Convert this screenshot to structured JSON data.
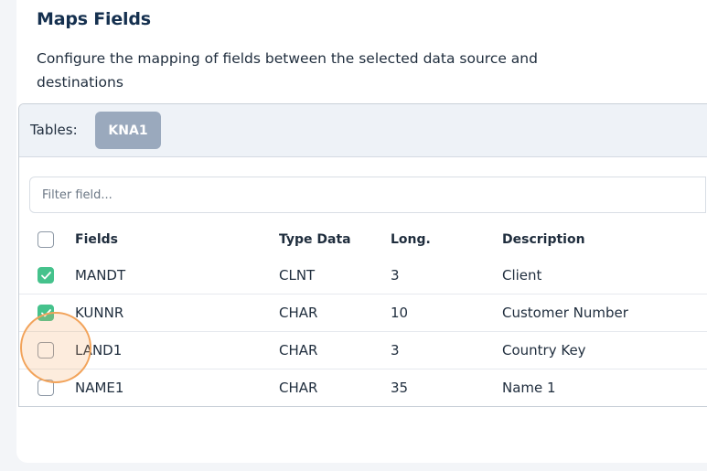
{
  "section": {
    "title": "Maps Fields",
    "description": "Configure the mapping of fields between the selected data source and destinations"
  },
  "tables": {
    "label": "Tables:",
    "selected": "KNA1"
  },
  "filter": {
    "placeholder": "Filter field...",
    "value": ""
  },
  "columns": {
    "fields": "Fields",
    "type": "Type Data",
    "long": "Long.",
    "description": "Description"
  },
  "rows": [
    {
      "field": "MANDT",
      "type": "CLNT",
      "long": "3",
      "description": "Client",
      "checked": true
    },
    {
      "field": "KUNNR",
      "type": "CHAR",
      "long": "10",
      "description": "Customer Number",
      "checked": true
    },
    {
      "field": "LAND1",
      "type": "CHAR",
      "long": "3",
      "description": "Country Key",
      "checked": false
    },
    {
      "field": "NAME1",
      "type": "CHAR",
      "long": "35",
      "description": "Name 1",
      "checked": false
    }
  ],
  "colors": {
    "accent_green": "#45c28c",
    "chip_bg": "#9aa9bd",
    "highlight": "#f2a35a",
    "title": "#15304f"
  }
}
